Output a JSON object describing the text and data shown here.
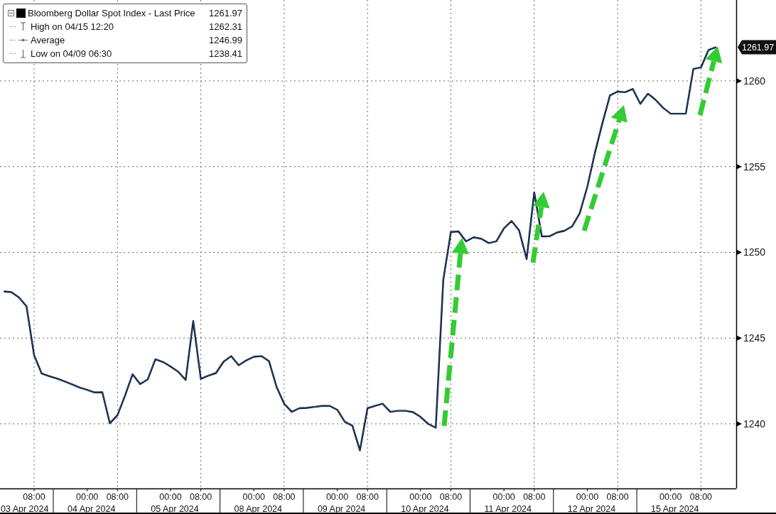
{
  "legend": {
    "series": {
      "value": "1261.97",
      "color": "#000000",
      "expanded": true
    },
    "rows": [
      {
        "kind": "high",
        "label": "High on 04/15 12:20",
        "value": "1262.31"
      },
      {
        "kind": "average",
        "label": "Average",
        "value": "1246.99"
      },
      {
        "kind": "low",
        "label": "Low on 04/09 06:30",
        "value": "1238.41"
      }
    ]
  },
  "chart": {
    "last_price_tag": "1261.97",
    "date_labels": [
      "03 Apr 2024",
      "04 Apr 2024",
      "05 Apr 2024",
      "08 Apr 2024",
      "09 Apr 2024",
      "10 Apr 2024",
      "11 Apr 2024",
      "12 Apr 2024",
      "15 Apr 2024"
    ],
    "chart_data": {
      "type": "line",
      "grid": true,
      "ylim": [
        1236.23,
        1264.72
      ],
      "yticks": [
        1240,
        1245,
        1250,
        1255,
        1260
      ],
      "categories": [
        null,
        null,
        null,
        null,
        "08:00",
        null,
        null,
        null,
        null,
        null,
        null,
        "00:00",
        null,
        null,
        null,
        "08:00",
        null,
        null,
        null,
        null,
        null,
        null,
        "00:00",
        null,
        null,
        null,
        "08:00",
        null,
        null,
        null,
        null,
        null,
        null,
        "00:00",
        null,
        null,
        null,
        "08:00",
        null,
        null,
        null,
        null,
        null,
        null,
        "00:00",
        null,
        null,
        null,
        "08:00",
        null,
        null,
        null,
        null,
        null,
        null,
        "00:00",
        null,
        null,
        null,
        "08:00",
        null,
        null,
        null,
        null,
        null,
        null,
        "00:00",
        null,
        null,
        null,
        "08:00",
        null,
        null,
        null,
        null,
        null,
        null,
        "00:00",
        null,
        null,
        null,
        "08:00",
        null,
        null,
        null,
        null,
        null,
        null,
        "00:00",
        null,
        null,
        null,
        "08:00",
        null,
        null
      ],
      "series": [
        {
          "name": "Bloomberg Dollar Spot Index - Last Price",
          "color": "#1f4e8c",
          "values": [
            1247.72,
            1247.68,
            1247.37,
            1246.85,
            1244.0,
            1242.93,
            1242.78,
            1242.64,
            1242.48,
            1242.3,
            1242.12,
            1241.98,
            1241.83,
            1241.84,
            1240.03,
            1240.5,
            1241.65,
            1242.89,
            1242.32,
            1242.6,
            1243.76,
            1243.61,
            1243.34,
            1243.04,
            1242.56,
            1246.0,
            1242.62,
            1242.81,
            1242.96,
            1243.62,
            1243.95,
            1243.41,
            1243.7,
            1243.91,
            1243.95,
            1243.65,
            1242.15,
            1241.17,
            1240.7,
            1240.91,
            1240.93,
            1240.99,
            1241.04,
            1241.04,
            1240.82,
            1240.12,
            1239.89,
            1238.45,
            1240.91,
            1241.05,
            1241.17,
            1240.7,
            1240.76,
            1240.76,
            1240.68,
            1240.4,
            1240.0,
            1239.77,
            1248.4,
            1251.19,
            1251.22,
            1250.64,
            1250.88,
            1250.8,
            1250.54,
            1250.65,
            1251.4,
            1251.83,
            1251.28,
            1249.61,
            1253.5,
            1250.93,
            1250.94,
            1251.16,
            1251.26,
            1251.52,
            1252.28,
            1253.83,
            1255.79,
            1257.55,
            1259.16,
            1259.38,
            1259.34,
            1259.53,
            1258.66,
            1259.26,
            1258.9,
            1258.43,
            1258.09,
            1258.09,
            1258.09,
            1260.7,
            1260.79,
            1261.81,
            1261.97
          ]
        }
      ]
    }
  }
}
